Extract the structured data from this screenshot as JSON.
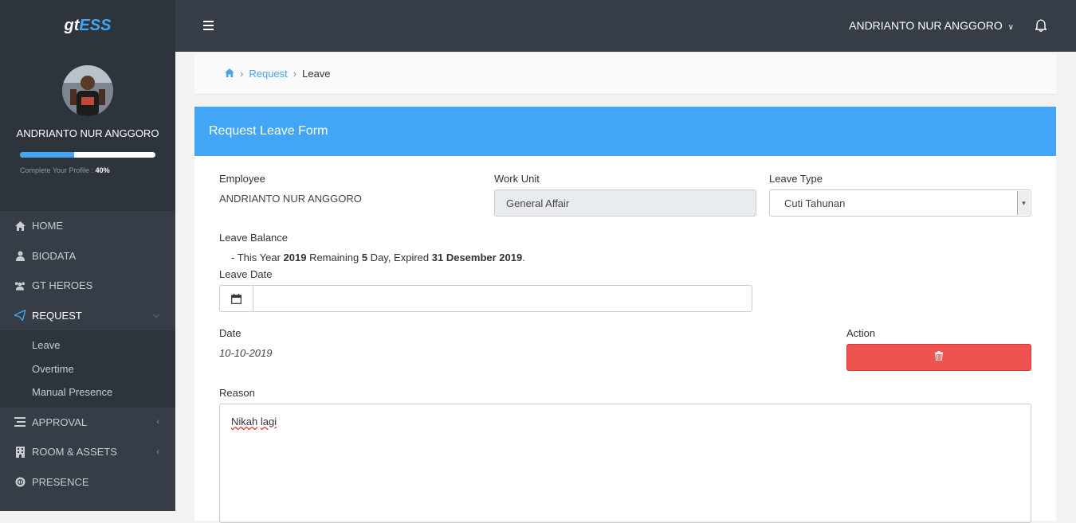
{
  "app": {
    "logo_part1": "gt",
    "logo_part2": "ESS"
  },
  "profile": {
    "name": "ANDRIANTO NUR ANGGORO",
    "progress_label": "Complete Your Profile : ",
    "progress_value": "40%",
    "progress_fraction": 0.4
  },
  "nav": {
    "home": "HOME",
    "biodata": "BIODATA",
    "heroes": "GT HEROES",
    "request": "REQUEST",
    "request_sub": [
      "Leave",
      "Overtime",
      "Manual Presence"
    ],
    "approval": "APPROVAL",
    "room": "ROOM & ASSETS",
    "presence": "PRESENCE"
  },
  "topbar": {
    "user": "ANDRIANTO NUR ANGGORO"
  },
  "breadcrumb": {
    "request": "Request",
    "leave": "Leave"
  },
  "form": {
    "title": "Request Leave Form",
    "employee_label": "Employee",
    "employee_value": "ANDRIANTO NUR ANGGORO",
    "work_unit_label": "Work Unit",
    "work_unit_value": "General Affair",
    "leave_type_label": "Leave Type",
    "leave_type_value": "Cuti Tahunan",
    "balance_label": "Leave Balance",
    "balance_prefix": "- This Year ",
    "balance_year": "2019",
    "balance_mid": " Remaining ",
    "balance_days": "5",
    "balance_mid2": " Day, Expired ",
    "balance_expired": "31 Desember 2019",
    "balance_end": ".",
    "leave_date_label": "Leave Date",
    "leave_date_value": "",
    "date_label": "Date",
    "date_value": "10-10-2019",
    "action_label": "Action",
    "reason_label": "Reason",
    "reason_word1": "Nikah",
    "reason_word2": "lagi"
  }
}
